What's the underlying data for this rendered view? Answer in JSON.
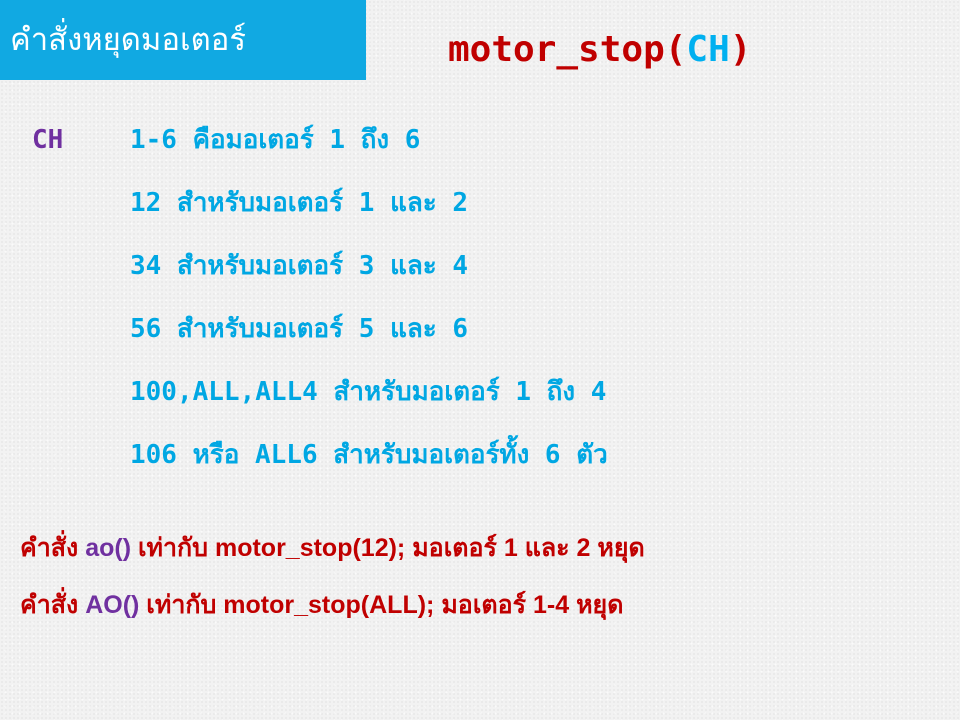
{
  "title": "คำสั่งหยุดมอเตอร์",
  "signature": {
    "name_open": "motor_stop(",
    "arg": "CH",
    "close": ")"
  },
  "ch_label": "CH",
  "ch_items": [
    "1-6 คือมอเตอร์ 1 ถึง 6",
    "12 สำหรับมอเตอร์ 1 และ 2",
    "34 สำหรับมอเตอร์ 3 และ 4",
    "56 สำหรับมอเตอร์ 5 และ 6",
    "100,ALL,ALL4 สำหรับมอเตอร์ 1 ถึง 4",
    "106 หรือ ALL6 สำหรับมอเตอร์ทั้ง 6 ตัว"
  ],
  "notes": [
    {
      "prefix": "คำสั่ง ",
      "code": "ao()",
      "suffix": " เท่ากับ motor_stop(12); มอเตอร์ 1 และ 2 หยุด"
    },
    {
      "prefix": "คำสั่ง ",
      "code": "AO()",
      "suffix": " เท่ากับ motor_stop(ALL); มอเตอร์ 1-4 หยุด"
    }
  ],
  "colors": {
    "title_bg": "#11a9e2",
    "function_name": "#c00000",
    "argument": "#00b0f0",
    "ch_label": "#7030a0",
    "ch_items": "#00a7e3",
    "notes": "#c00000",
    "notes_code": "#7030a0"
  }
}
